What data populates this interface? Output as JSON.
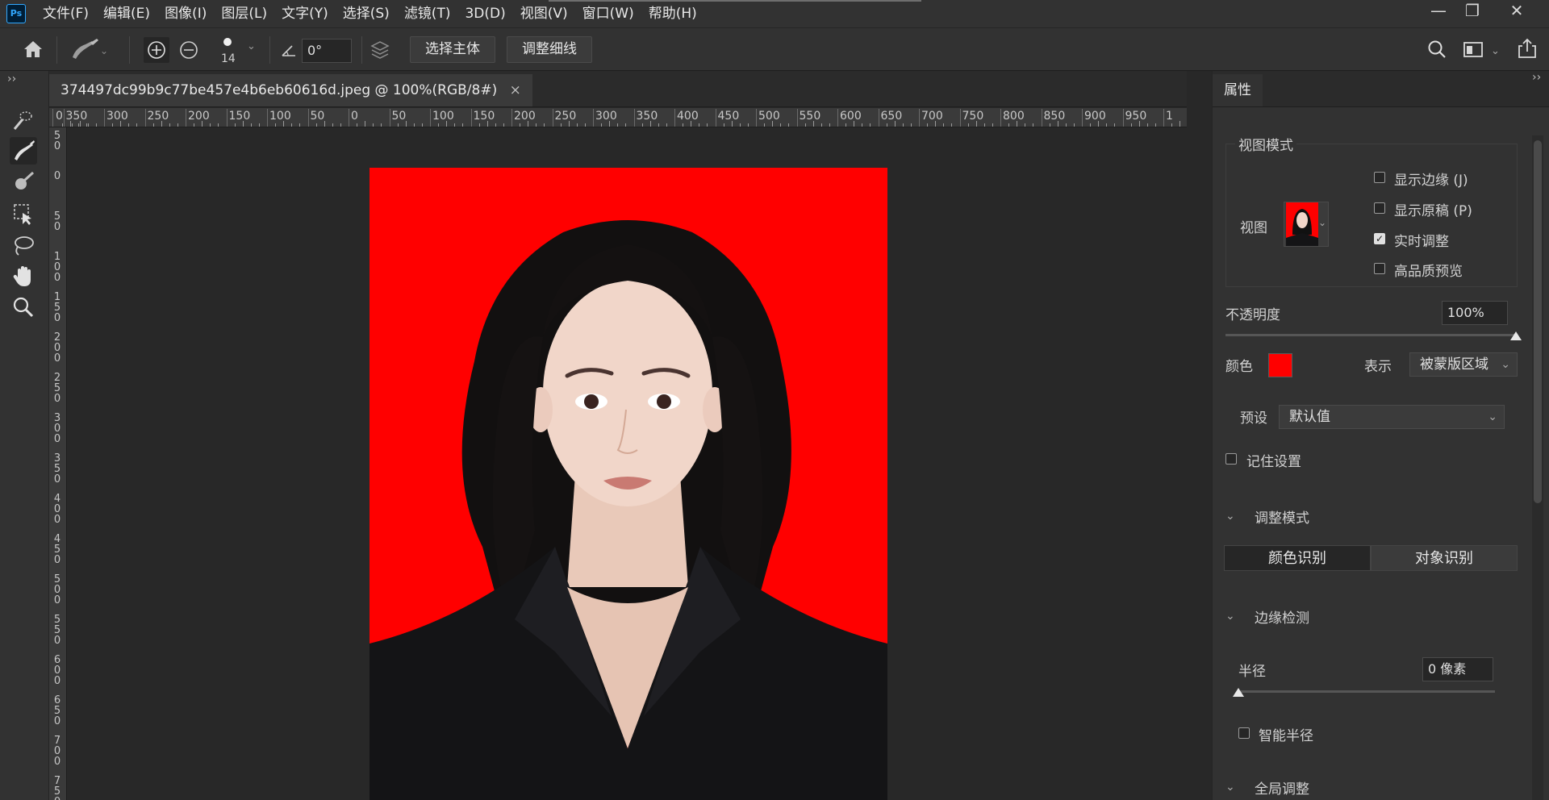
{
  "app": {
    "logo": "Ps"
  },
  "menu": {
    "items": [
      "文件(F)",
      "编辑(E)",
      "图像(I)",
      "图层(L)",
      "文字(Y)",
      "选择(S)",
      "滤镜(T)",
      "3D(D)",
      "视图(V)",
      "窗口(W)",
      "帮助(H)"
    ]
  },
  "window_controls": {
    "minimize": "—",
    "restore": "❐",
    "close": "✕"
  },
  "options": {
    "brush_size": "14",
    "angle": "0°",
    "select_subject": "选择主体",
    "refine_hair": "调整细线"
  },
  "document": {
    "tab_title": "374497dc99b9c77be457e4b6eb60616d.jpeg @ 100%(RGB/8#)",
    "close": "×"
  },
  "ruler": {
    "h_labels": [
      "0",
      "350",
      "300",
      "250",
      "200",
      "150",
      "100",
      "50",
      "0",
      "50",
      "100",
      "150",
      "200",
      "250",
      "300",
      "350",
      "400",
      "450",
      "500",
      "550",
      "600",
      "650",
      "700",
      "750",
      "800",
      "850",
      "900",
      "950",
      "1"
    ],
    "v_labels": [
      "50",
      "0",
      "50",
      "100",
      "150",
      "200",
      "250",
      "300",
      "350",
      "400",
      "450",
      "500",
      "550",
      "600",
      "650",
      "700",
      "750"
    ]
  },
  "colors": {
    "photo_background": "#ff0000",
    "overlay_color": "#ff0000"
  },
  "panel": {
    "tab": "属性",
    "expand": "››",
    "view_mode": {
      "title": "视图模式",
      "view_label": "视图",
      "options": [
        {
          "label": "显示边缘 (J)",
          "checked": false
        },
        {
          "label": "显示原稿 (P)",
          "checked": false
        },
        {
          "label": "实时调整",
          "checked": true
        },
        {
          "label": "高品质预览",
          "checked": false
        }
      ]
    },
    "opacity": {
      "label": "不透明度",
      "value": "100%",
      "level": 100
    },
    "color": {
      "label": "颜色"
    },
    "show": {
      "label": "表示",
      "value": "被蒙版区域"
    },
    "preset": {
      "label": "预设",
      "value": "默认值"
    },
    "remember": {
      "label": "记住设置",
      "checked": false
    },
    "adjust_mode": {
      "title": "调整模式",
      "segments": [
        "颜色识别",
        "对象识别"
      ],
      "active": 0
    },
    "edge_detection": {
      "title": "边缘检测",
      "radius_label": "半径",
      "radius_value": "0 像素",
      "radius_level": 0,
      "smart_radius": {
        "label": "智能半径",
        "checked": false
      }
    },
    "global": {
      "title": "全局调整"
    }
  },
  "icons": {
    "home": "home-icon",
    "brush": "refine-brush-icon",
    "add": "add-to-selection-icon",
    "subtract": "subtract-from-selection-icon",
    "angle": "angle-icon",
    "sample_layers": "sample-all-layers-icon",
    "search": "search-icon",
    "workspace": "workspace-icon",
    "share": "share-icon"
  }
}
